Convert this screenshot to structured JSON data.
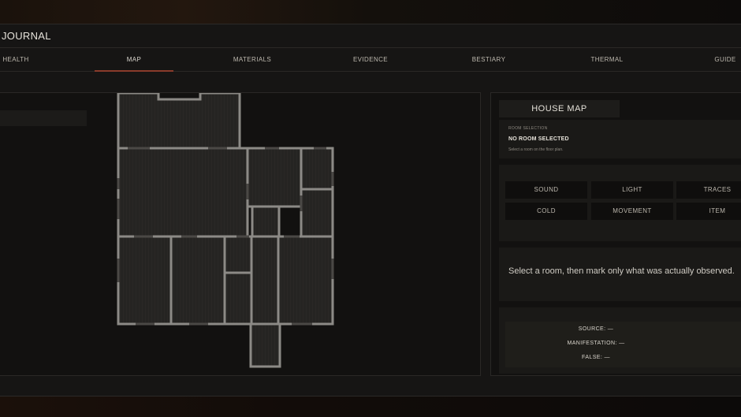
{
  "journal": {
    "title": "JOURNAL"
  },
  "tabs": [
    "HEALTH",
    "MAP",
    "MATERIALS",
    "EVIDENCE",
    "BESTIARY",
    "THERMAL",
    "GUIDE"
  ],
  "active_tab": "MAP",
  "side": {
    "title": "HOUSE MAP",
    "selection": {
      "caption": "ROOM SELECTION",
      "value": "NO ROOM SELECTED",
      "hint": "Select a room on the floor plan."
    },
    "observations": [
      "SOUND",
      "LIGHT",
      "TRACES",
      "COLD",
      "MOVEMENT",
      "ITEM"
    ],
    "message": "Select a room, then mark only what was actually observed.",
    "results": {
      "source": "SOURCE: —",
      "manifestation": "MANIFESTATION: —",
      "false": "FALSE: —"
    }
  },
  "colors": {
    "accent": "#8a3b2b",
    "wall": "#8c8a86",
    "room_fill": "#252422",
    "panel": "#161514"
  }
}
